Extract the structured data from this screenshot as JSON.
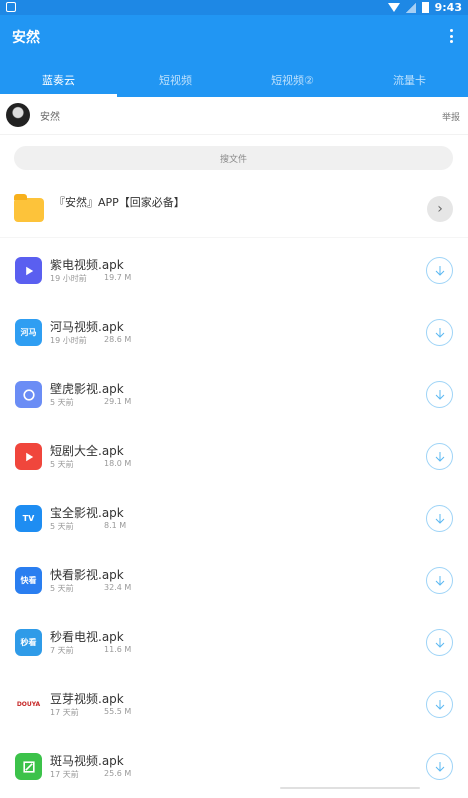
{
  "status_bar": {
    "time": "9:43"
  },
  "app_bar": {
    "title": "安然"
  },
  "tabs": [
    {
      "label": "蓝奏云",
      "active": true
    },
    {
      "label": "短视频",
      "active": false
    },
    {
      "label": "短视频②",
      "active": false
    },
    {
      "label": "流量卡",
      "active": false
    }
  ],
  "user": {
    "name": "安然",
    "report_label": "举报"
  },
  "search": {
    "placeholder": "搜文件"
  },
  "folder": {
    "name": "『安然』APP【回家必备】"
  },
  "files": [
    {
      "name": "紫电视频.apk",
      "time": "19 小时前",
      "size": "19.7 M",
      "icon": "play-icon",
      "icon_text": "",
      "color": "#5a5ff0"
    },
    {
      "name": "河马视频.apk",
      "time": "19 小时前",
      "size": "28.6 M",
      "icon": "hippo-icon",
      "icon_text": "河马",
      "color": "#2f9ef2"
    },
    {
      "name": "壁虎影视.apk",
      "time": "5 天前",
      "size": "29.1 M",
      "icon": "gecko-icon",
      "icon_text": "",
      "color": "#6b8df5"
    },
    {
      "name": "短剧大全.apk",
      "time": "5 天前",
      "size": "18.0 M",
      "icon": "play-icon",
      "icon_text": "",
      "color": "#f0463c"
    },
    {
      "name": "宝全影视.apk",
      "time": "5 天前",
      "size": "8.1 M",
      "icon": "tv-icon",
      "icon_text": "TV",
      "color": "#1e8df2"
    },
    {
      "name": "快看影视.apk",
      "time": "5 天前",
      "size": "32.4 M",
      "icon": "kuaikan-icon",
      "icon_text": "快看",
      "color": "#2a7ef0"
    },
    {
      "name": "秒看电视.apk",
      "time": "7 天前",
      "size": "11.6 M",
      "icon": "tv-icon",
      "icon_text": "秒看",
      "color": "#2f9be8"
    },
    {
      "name": "豆芽视频.apk",
      "time": "17 天前",
      "size": "55.5 M",
      "icon": "douya-icon",
      "icon_text": "DOUYA",
      "color": "#ffffff"
    },
    {
      "name": "斑马视频.apk",
      "time": "17 天前",
      "size": "25.6 M",
      "icon": "zebra-icon",
      "icon_text": "",
      "color": "#3cc24a"
    }
  ]
}
